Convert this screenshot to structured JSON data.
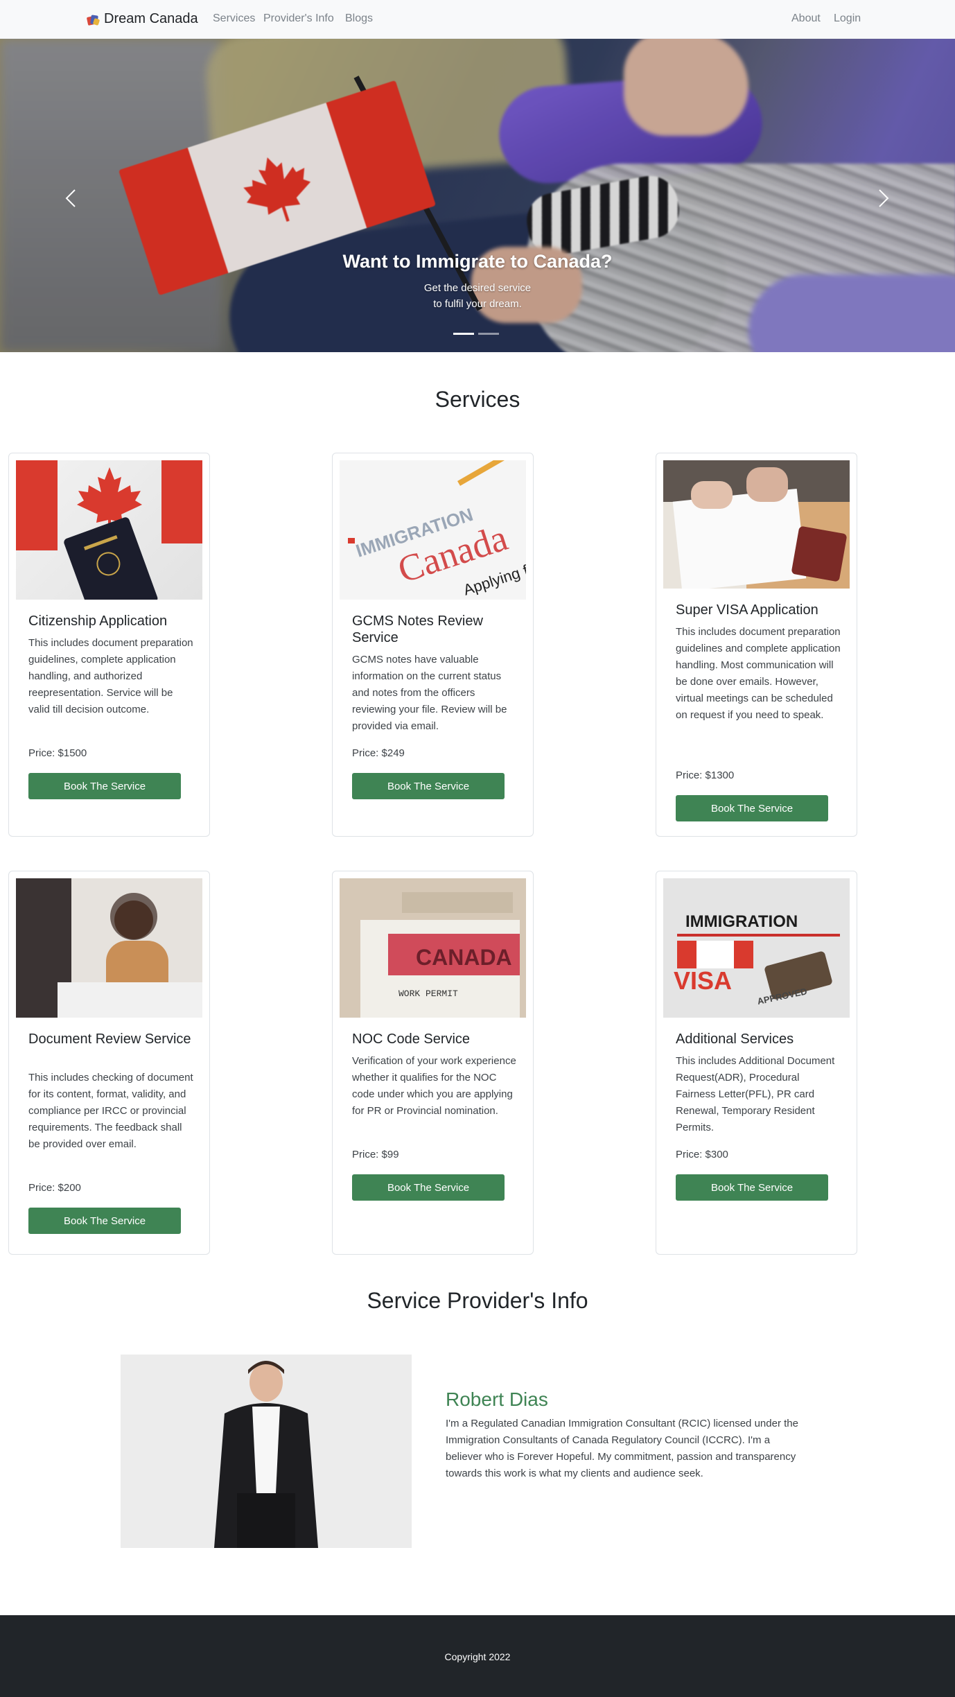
{
  "navbar": {
    "brand": "Dream Canada",
    "links": [
      "Services",
      "Provider's Info",
      "Blogs"
    ],
    "right_links": [
      "About",
      "Login"
    ]
  },
  "hero": {
    "title": "Want to Immigrate to Canada?",
    "subtitle_line1": "Get the desired service",
    "subtitle_line2": "to fulfil your dream.",
    "slide_count": 2,
    "active_slide": 1
  },
  "services": {
    "heading": "Services",
    "button_label": "Book The Service",
    "items": [
      {
        "title": "Citizenship Application",
        "description": "This includes document preparation guidelines, complete application handling, and authorized reepresentation. Service will be valid till decision outcome.",
        "price": "Price: $1500"
      },
      {
        "title": "GCMS Notes Review Service",
        "description": "GCMS notes have valuable information on the current status and notes from the officers reviewing your file. Review will be provided via email.",
        "price": "Price: $249"
      },
      {
        "title": "Super VISA Application",
        "description": "This includes document preparation guidelines and complete application handling. Most communication will be done over emails. However, virtual meetings can be scheduled on request if you need to speak.",
        "price": "Price: $1300"
      },
      {
        "title": "Document Review Service",
        "description": "This includes checking of document for its content, format, validity, and compliance per IRCC or provincial requirements. The feedback shall be provided over email.",
        "price": "Price: $200"
      },
      {
        "title": "NOC Code Service",
        "description": "Verification of your work experience whether it qualifies for the NOC code under which you are applying for PR or Provincial nomination.",
        "price": "Price: $99"
      },
      {
        "title": "Additional Services",
        "description": "This includes Additional Document Request(ADR), Procedural Fairness Letter(PFL), PR card Renewal, Temporary Resident Permits.",
        "price": "Price: $300"
      }
    ],
    "image_text": {
      "gcms_word1": "IMMIGRATION",
      "gcms_word2": "Canada",
      "gcms_word3": "Applying for a",
      "noc_word1": "CANADA",
      "noc_word2": "WORK PERMIT",
      "add_word1": "IMMIGRATION",
      "add_word2": "VISA",
      "add_word3": "APPROVED"
    }
  },
  "provider": {
    "heading": "Service Provider's Info",
    "name": "Robert Dias",
    "bio": "I'm a Regulated Canadian Immigration Consultant (RCIC) licensed under the Immigration Consultants of Canada Regulatory Council (ICCRC). I'm a believer who is Forever Hopeful. My commitment, passion and transparency towards this work is what my clients and audience seek."
  },
  "footer": {
    "copyright": "Copyright 2022"
  },
  "colors": {
    "accent_green": "#3f8454",
    "navbar_bg": "#f8f9fa",
    "footer_bg": "#212529"
  },
  "icons": [
    "chevron-left-icon",
    "chevron-right-icon",
    "maple-leaf-icon",
    "brand-logo-icon"
  ]
}
